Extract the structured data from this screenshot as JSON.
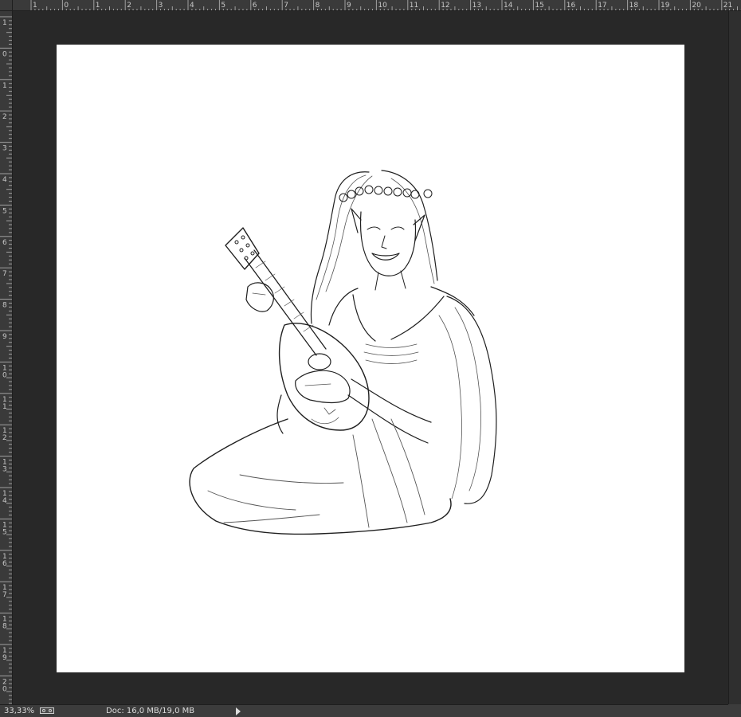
{
  "rulers": {
    "top_labels": [
      "1",
      "0",
      "1",
      "2",
      "3",
      "4",
      "5",
      "6",
      "7",
      "8",
      "9",
      "10",
      "11",
      "12",
      "13",
      "14",
      "15",
      "16",
      "17",
      "18",
      "19",
      "20",
      "21"
    ],
    "left_labels": [
      "1",
      "0",
      "1",
      "2",
      "3",
      "4",
      "5",
      "6",
      "7",
      "8",
      "9",
      "10",
      "11",
      "12",
      "13",
      "14",
      "15",
      "16",
      "17",
      "18",
      "19",
      "20"
    ]
  },
  "canvas": {
    "artwork_icon": "sketch-elf-lute-player-icon",
    "background": "#ffffff"
  },
  "statusbar": {
    "zoom": "33,33%",
    "doc_size": "Doc: 16,0 MB/19,0 MB",
    "zoom_icon": "zoom-toggle-icon",
    "menu_icon": "triangle-right-icon"
  },
  "colors": {
    "workspace": "#282828",
    "ruler": "#3a3a3a",
    "statusbar": "#3c3c3c"
  }
}
